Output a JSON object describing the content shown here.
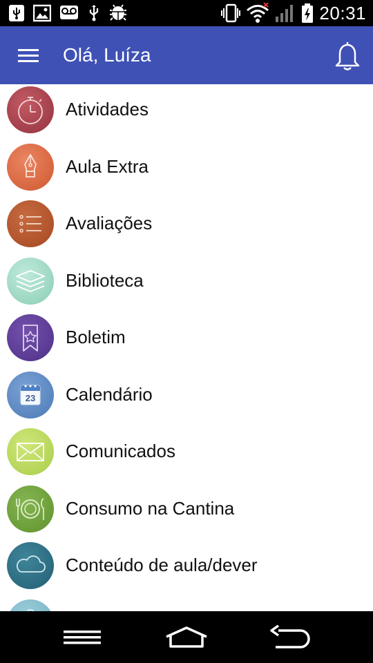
{
  "status_bar": {
    "time": "20:31",
    "left_icons": [
      "usb-icon",
      "image-icon",
      "voicemail-icon",
      "usb-debug-icon",
      "android-debug-icon"
    ],
    "right_icons": [
      "vibrate-icon",
      "wifi-icon",
      "signal-icon",
      "battery-charging-icon"
    ]
  },
  "app_bar": {
    "title": "Olá, Luíza",
    "menu_icon": "hamburger-menu-icon",
    "notification_icon": "bell-icon"
  },
  "menu": {
    "items": [
      {
        "label": "Atividades",
        "icon": "stopwatch-icon",
        "color": "#a9434f"
      },
      {
        "label": "Aula Extra",
        "icon": "fountain-pen-icon",
        "color": "#d96a4c"
      },
      {
        "label": "Avaliações",
        "icon": "list-icon",
        "color": "#b5562f"
      },
      {
        "label": "Biblioteca",
        "icon": "layers-icon",
        "color": "#9fd9c4"
      },
      {
        "label": "Boletim",
        "icon": "bookmark-star-icon",
        "color": "#5d3d96"
      },
      {
        "label": "Calendário",
        "icon": "calendar-icon",
        "color": "#5a86c0"
      },
      {
        "label": "Comunicados",
        "icon": "envelope-icon",
        "color": "#b7d85a"
      },
      {
        "label": "Consumo na Cantina",
        "icon": "plate-cutlery-icon",
        "color": "#6fa33c"
      },
      {
        "label": "Conteúdo de aula/dever",
        "icon": "cloud-icon",
        "color": "#2f6f86"
      },
      {
        "label": "",
        "icon": "partial-icon",
        "color": "#7fb8c7"
      }
    ],
    "calendar_day": "23"
  },
  "nav_bar": {
    "buttons": [
      "recent-apps-icon",
      "home-icon",
      "back-icon"
    ]
  }
}
